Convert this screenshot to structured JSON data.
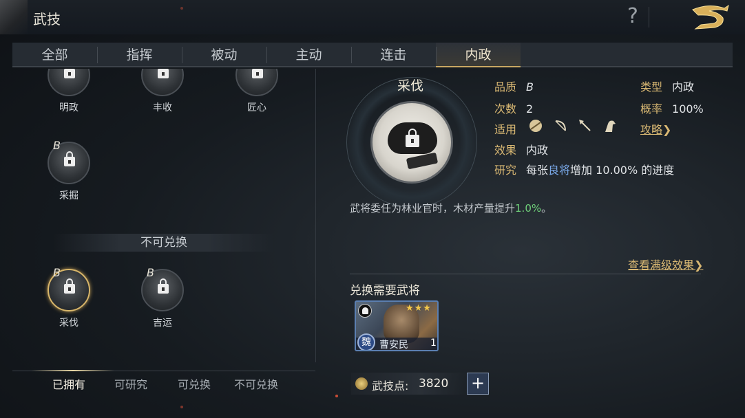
{
  "header": {
    "title": "武技"
  },
  "tabs": [
    {
      "label": "全部"
    },
    {
      "label": "指挥"
    },
    {
      "label": "被动"
    },
    {
      "label": "主动"
    },
    {
      "label": "连击"
    },
    {
      "label": "内政"
    }
  ],
  "active_tab": "内政",
  "skills_owned": [
    {
      "name": "明政",
      "grade": ""
    },
    {
      "name": "丰收",
      "grade": ""
    },
    {
      "name": "匠心",
      "grade": ""
    },
    {
      "name": "采掘",
      "grade": "B"
    }
  ],
  "section_unexchangeable": "不可兑换",
  "skills_unexchangeable": [
    {
      "name": "采伐",
      "grade": "B"
    },
    {
      "name": "吉运",
      "grade": "B"
    }
  ],
  "detail": {
    "name": "采伐",
    "quality_label": "品质",
    "quality_value": "B",
    "type_label": "类型",
    "type_value": "内政",
    "count_label": "次数",
    "count_value": "2",
    "rate_label": "概率",
    "rate_value": "100%",
    "apply_label": "适用",
    "apply_icons": [
      "shield-icon",
      "bow-icon",
      "spear-icon",
      "horse-icon"
    ],
    "strategy_link": "攻略",
    "effect_label": "效果",
    "effect_value": "内政",
    "research_label": "研究",
    "research_pre": "每张",
    "research_hl": "良将",
    "research_post": "增加 10.00% 的进度",
    "description_main": "武将委任为林业官时，木材产量提升",
    "description_value": "1.0%",
    "description_end": "。",
    "view_max_link": "查看满级效果",
    "required_title": "兑换需要武将",
    "required_hero": {
      "name": "曹安民",
      "faction": "魏",
      "stars": "★★★",
      "count": "1"
    }
  },
  "filters": [
    {
      "label": "已拥有"
    },
    {
      "label": "可研究"
    },
    {
      "label": "可兑换"
    },
    {
      "label": "不可兑换"
    }
  ],
  "active_filter": "已拥有",
  "points": {
    "label": "武技点:",
    "value": "3820",
    "plus": "+"
  },
  "colors": {
    "gold": "#d9b873",
    "highlight_blue": "#79a8e8",
    "highlight_green": "#6fd07a"
  }
}
